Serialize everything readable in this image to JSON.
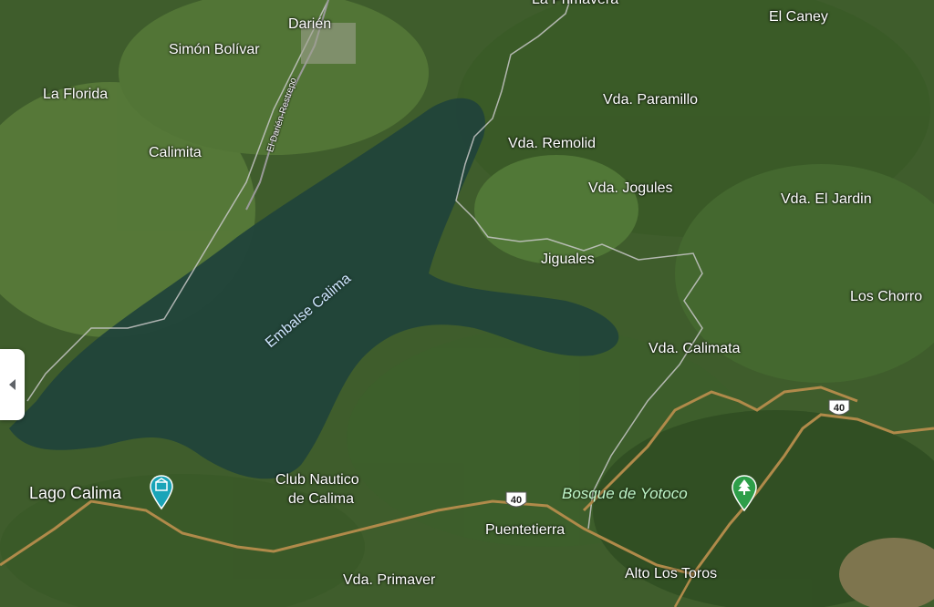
{
  "places": {
    "la_primavera": "La Primavera",
    "darien": "Darién",
    "el_caney": "El Caney",
    "simon_bolivar": "Simón Bolívar",
    "la_florida": "La Florida",
    "vda_paramillo": "Vda. Paramillo",
    "vda_remolid": "Vda. Remolid",
    "calimita": "Calimita",
    "vda_jogules": "Vda. Jogules",
    "vda_el_jardin": "Vda. El Jardin",
    "jiguales": "Jiguales",
    "los_chorros": "Los Chorro",
    "vda_calimata": "Vda. Calimata",
    "club_nautico_1": "Club Nautico",
    "club_nautico_2": "de Calima",
    "lago_calima": "Lago Calima",
    "puentetierra": "Puentetierra",
    "vda_primaver": "Vda. Primaver",
    "alto_los_toros": "Alto Los Toros"
  },
  "water": {
    "embalse": "Embalse Calima"
  },
  "roads": {
    "darien_restrepo": "El Darién-Restrepo",
    "route_40": "40"
  },
  "poi": {
    "bosque": "Bosque de Yotoco",
    "bosque_icon": "tree-icon",
    "lago_icon": "museum-icon"
  },
  "colors": {
    "water": "#21433a",
    "road": "#b08a4a",
    "boundary": "#c8c8c8",
    "poi_teal": "#1aa4b8",
    "poi_green": "#2e9e49"
  }
}
